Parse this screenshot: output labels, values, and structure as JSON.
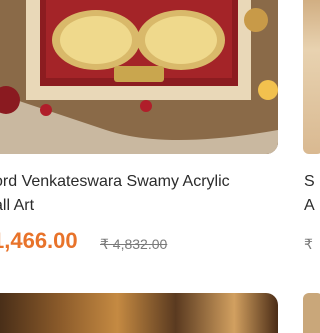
{
  "product": {
    "title_line1": "ord Venkateswara Swamy Acrylic",
    "title_line2": "all Art",
    "price": "1,466.00",
    "mrp": "₹ 4,832.00"
  },
  "peek": {
    "title_line1": "S",
    "title_line2": "A",
    "price": "₹"
  },
  "colors": {
    "price": "#e8732a",
    "mrp": "#7a7a7a",
    "title": "#2b2b2b"
  }
}
